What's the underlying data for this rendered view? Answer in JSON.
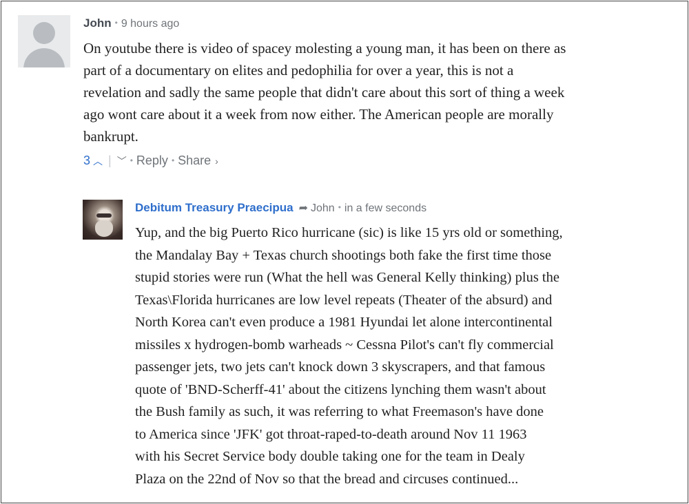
{
  "comments": [
    {
      "author": "John",
      "time": "9 hours ago",
      "lines": [
        "On youtube there is video of spacey molesting a young man, it has been on there as",
        "part of a documentary on elites and pedophilia for over a year, this is not a",
        "revelation and sadly the same people that didn't care about this sort of thing a week",
        "ago wont care about it a week from now either. The American people are morally",
        "bankrupt."
      ],
      "votes": "3",
      "reply_label": "Reply",
      "share_label": "Share"
    },
    {
      "author": "Debitum Treasury Praecipua",
      "reply_to": "John",
      "time": "in a few seconds",
      "lines": [
        "Yup, and the big Puerto Rico hurricane (sic) is like 15 yrs old or something,",
        "the Mandalay Bay + Texas church shootings both fake the first time those",
        "stupid stories were run (What the hell was General Kelly thinking) plus the",
        "Texas\\Florida hurricanes are low level repeats (Theater of the absurd) and",
        "North Korea can't even produce a 1981 Hyundai let alone intercontinental",
        "missiles x hydrogen-bomb warheads ~ Cessna Pilot's can't fly commercial",
        "passenger jets, two jets can't knock down 3 skyscrapers, and that famous",
        "quote of 'BND-Scherff-41' about the citizens lynching them wasn't about",
        "the Bush family as such, it was referring to what Freemason's have done",
        "to America since 'JFK' got throat-raped-to-death around Nov 11 1963",
        "with his Secret Service body double taking one for the team in Dealy",
        "Plaza on the 22nd of Nov so that the bread and circuses continued..."
      ]
    }
  ]
}
